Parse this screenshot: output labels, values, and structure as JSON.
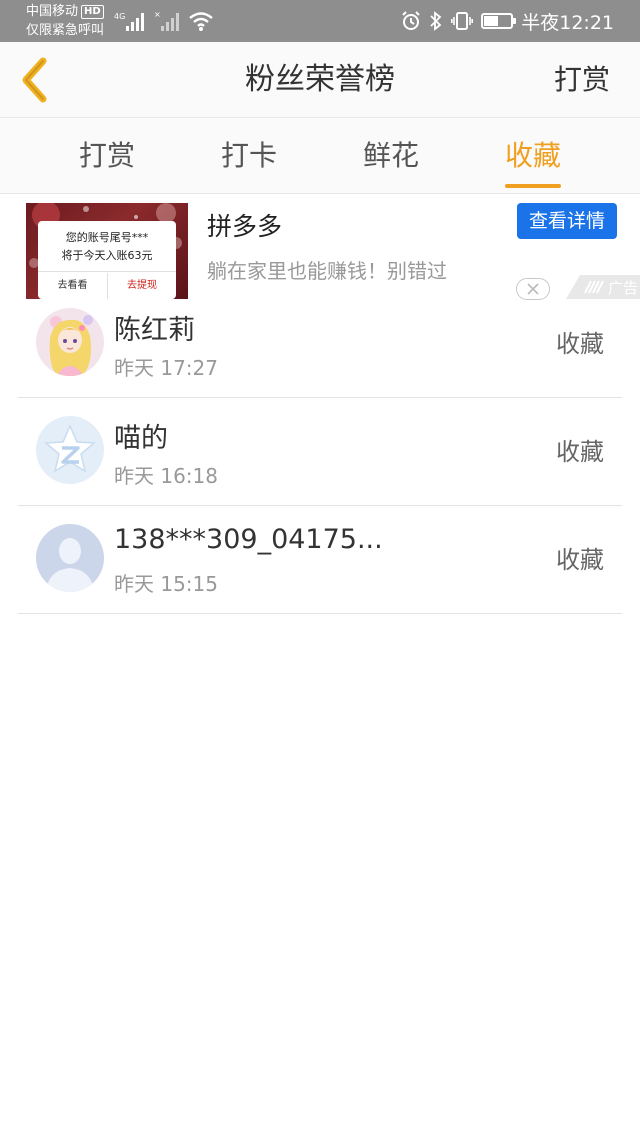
{
  "status_bar": {
    "carrier": "中国移动",
    "hd": "HD",
    "emergency_text": "仅限紧急呼叫",
    "network_type": "4G",
    "battery_level": 0.5,
    "time": "半夜12:21"
  },
  "header": {
    "title": "粉丝荣誉榜",
    "action": "打赏"
  },
  "tabs": [
    {
      "label": "打赏",
      "active": false
    },
    {
      "label": "打卡",
      "active": false
    },
    {
      "label": "鲜花",
      "active": false
    },
    {
      "label": "收藏",
      "active": true
    }
  ],
  "ad": {
    "image_line1": "您的账号尾号***",
    "image_line2": "将于今天入账63元",
    "image_button_left": "去看看",
    "image_button_right": "去提现",
    "title": "拼多多",
    "description": "躺在家里也能赚钱！别错过",
    "detail_button": "查看详情",
    "tag": "广告"
  },
  "list": [
    {
      "name": "陈红莉",
      "time": "昨天 17:27",
      "action": "收藏",
      "avatar": "anime-girl-avatar"
    },
    {
      "name": "喵的",
      "time": "昨天 16:18",
      "action": "收藏",
      "avatar": "qzone-star-avatar"
    },
    {
      "name": "138***309_04175...",
      "time": "昨天 15:15",
      "action": "收藏",
      "avatar": "default-person-avatar"
    }
  ],
  "colors": {
    "accent": "#f0a020",
    "ad_button": "#1a73e8",
    "status_bar": "#8e8e8e"
  }
}
